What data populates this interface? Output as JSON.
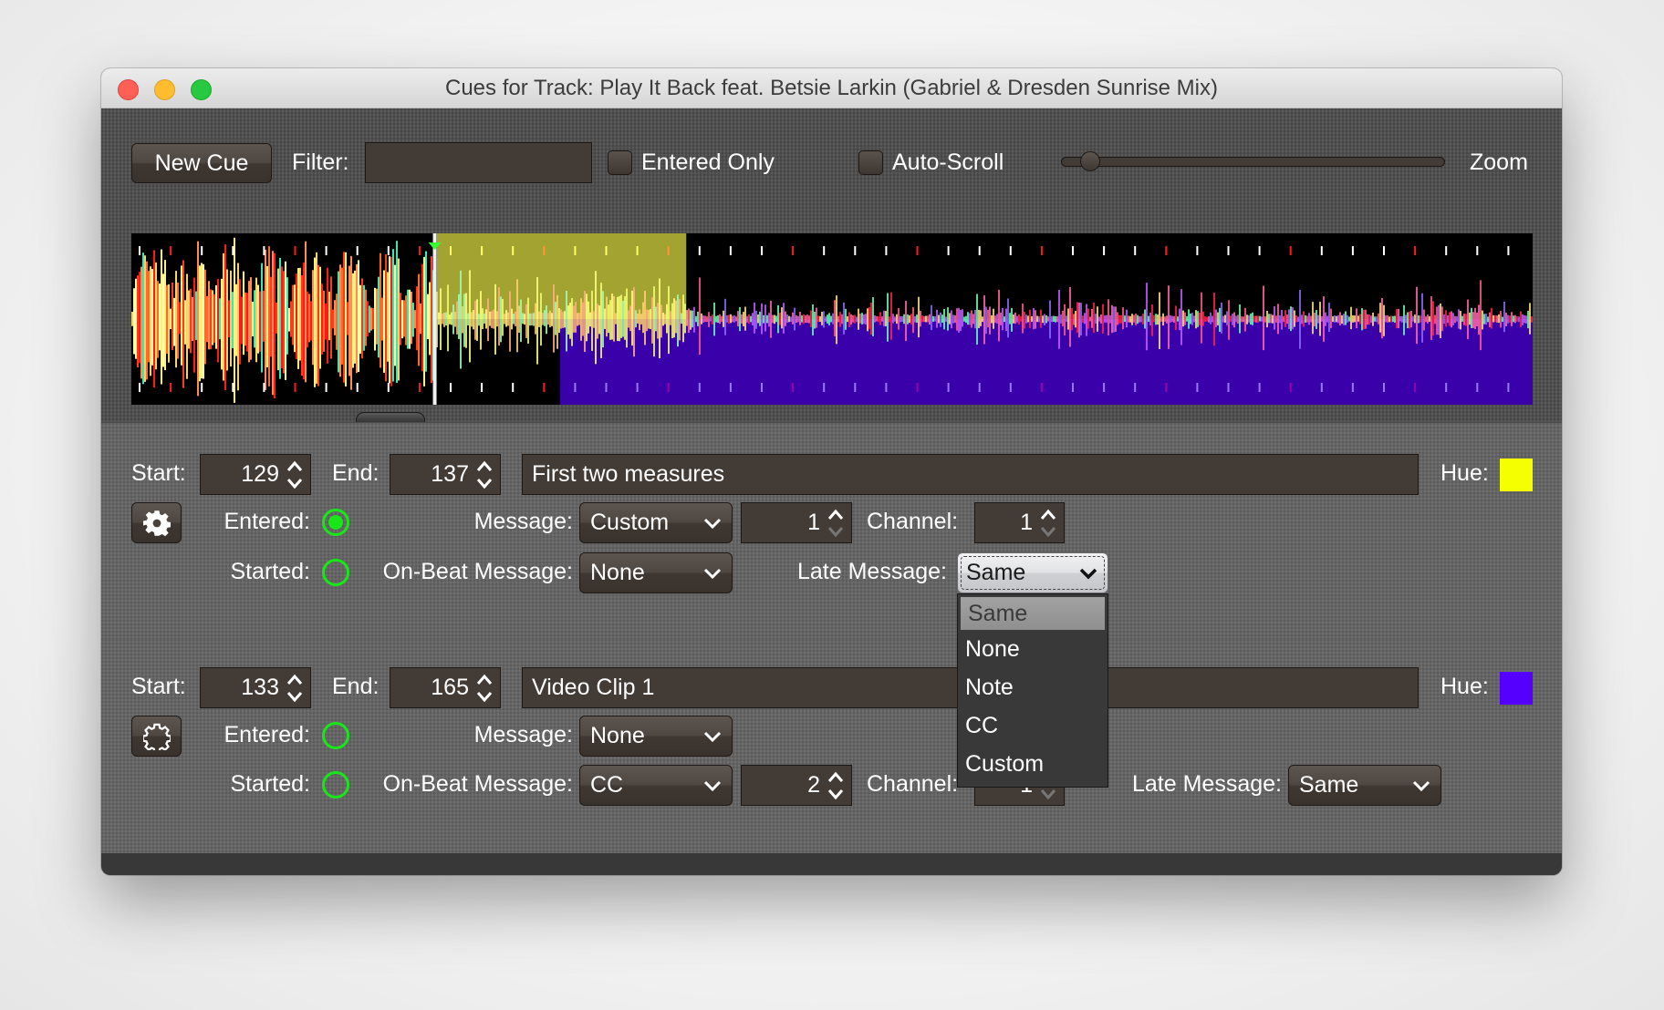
{
  "window": {
    "title": "Cues for Track: Play It Back feat. Betsie Larkin (Gabriel & Dresden Sunrise Mix)",
    "traffic_lights": {
      "close": "#fe5f57",
      "minimize": "#febc2e",
      "zoom": "#28c840"
    }
  },
  "toolbar": {
    "new_cue_label": "New Cue",
    "filter_label": "Filter:",
    "filter_value": "",
    "entered_only_label": "Entered Only",
    "entered_only_checked": false,
    "auto_scroll_label": "Auto-Scroll",
    "auto_scroll_checked": false,
    "zoom_label": "Zoom",
    "zoom_slider_fraction": 0.05
  },
  "waveform": {
    "playhead_fraction": 0.2165,
    "background": "#000000",
    "cue_regions": [
      {
        "cue": "First two measures",
        "hue": "#f5ff00",
        "start_fraction": 0.218,
        "end_fraction": 0.396,
        "half": "top",
        "overlay": "#a3a332"
      },
      {
        "cue": "Video Clip 1",
        "hue": "#5500ff",
        "start_fraction": 0.306,
        "end_fraction": 1.0,
        "half": "bottom",
        "overlay": "#3a00aa"
      }
    ],
    "scroll_thumb_fraction": 0.16
  },
  "labels": {
    "start": "Start:",
    "end": "End:",
    "hue": "Hue:",
    "entered": "Entered:",
    "started": "Started:",
    "message": "Message:",
    "on_beat_message": "On-Beat Message:",
    "late_message": "Late Message:",
    "channel": "Channel:"
  },
  "cues": [
    {
      "start": "129",
      "end": "137",
      "comment": "First two measures",
      "hue_color": "#f5ff00",
      "entered_active": true,
      "started_active": false,
      "message": "Custom",
      "message_note": "1",
      "message_channel": "1",
      "on_beat_message": "None",
      "late_message": "Same",
      "late_message_open": true
    },
    {
      "start": "133",
      "end": "165",
      "comment": "Video Clip 1",
      "hue_color": "#5500ff",
      "entered_active": false,
      "started_active": false,
      "message": "None",
      "on_beat_message": "CC",
      "on_beat_note": "2",
      "on_beat_channel": "1",
      "late_message": "Same"
    }
  ],
  "late_message_popup": {
    "options": [
      "Same",
      "None",
      "Note",
      "CC",
      "Custom"
    ],
    "highlighted": "Same"
  }
}
